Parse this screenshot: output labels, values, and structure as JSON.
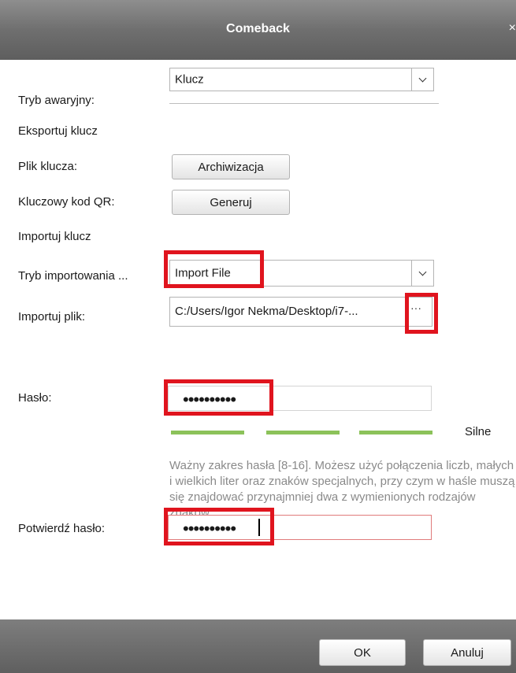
{
  "window": {
    "title": "Comeback",
    "close_glyph": "×"
  },
  "form": {
    "emergency_mode": {
      "label": "Tryb awaryjny:",
      "value": "Klucz"
    },
    "export_heading": "Eksportuj klucz",
    "key_file": {
      "label": "Plik klucza:",
      "button": "Archiwizacja"
    },
    "qr_code": {
      "label": "Kluczowy kod QR:",
      "button": "Generuj"
    },
    "import_heading": "Importuj klucz",
    "import_mode": {
      "label": "Tryb importowania ...",
      "value": "Import File"
    },
    "import_file": {
      "label": "Importuj plik:",
      "value": "C:/Users/Igor Nekma/Desktop/i7-...",
      "browse_glyph": "···"
    },
    "password": {
      "label": "Hasło:",
      "masked": "••••••••••"
    },
    "strength": {
      "label": "Silne",
      "segments_filled": 3,
      "segments_total": 3,
      "color": "#8cc25a"
    },
    "hint": "Ważny zakres hasła [8-16]. Możesz użyć połączenia liczb, małych i wielkich liter oraz znaków specjalnych, przy czym w haśle muszą się znajdować przynajmniej dwa z wymienionych rodzajów znaków.",
    "confirm_password": {
      "label": "Potwierdź hasło:",
      "masked": "••••••••••"
    }
  },
  "footer": {
    "ok_label": "OK",
    "cancel_label": "Anuluj"
  },
  "colors": {
    "highlight": "#e0141e",
    "strength_bar": "#8cc25a",
    "titlebar": "#6f6f6f"
  }
}
